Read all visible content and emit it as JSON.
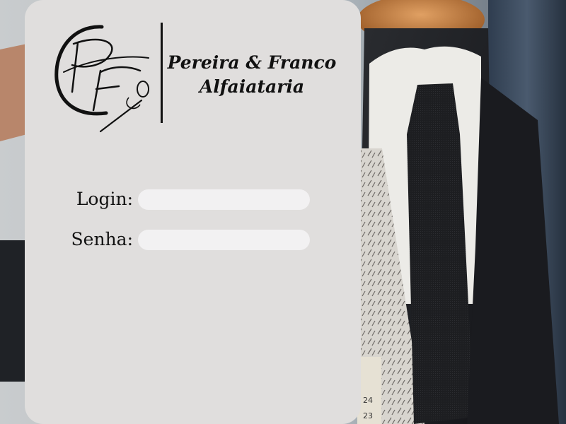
{
  "brand": {
    "monogram": "PF",
    "name_line1": "Pereira & Franco",
    "name_line2": "Alfaiataria"
  },
  "form": {
    "login_label": "Login:",
    "login_value": "",
    "password_label": "Senha:",
    "password_value": ""
  },
  "background": {
    "tape_numbers": [
      "24",
      "23"
    ]
  },
  "colors": {
    "panel": "#e0dedd",
    "input": "#f2f1f2",
    "ink": "#111111"
  }
}
